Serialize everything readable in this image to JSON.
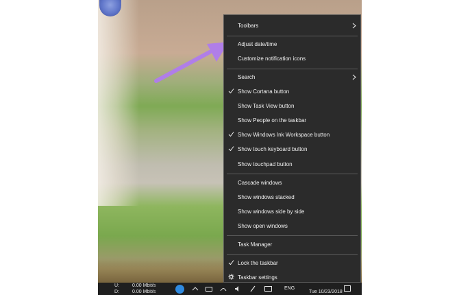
{
  "menu": {
    "items": [
      {
        "label": "Toolbars",
        "checked": false,
        "submenu": true
      },
      {
        "label": "Adjust date/time",
        "checked": false,
        "submenu": false
      },
      {
        "label": "Customize notification icons",
        "checked": false,
        "submenu": false
      },
      {
        "label": "Search",
        "checked": false,
        "submenu": true
      },
      {
        "label": "Show Cortana button",
        "checked": true,
        "submenu": false
      },
      {
        "label": "Show Task View button",
        "checked": false,
        "submenu": false
      },
      {
        "label": "Show People on the taskbar",
        "checked": false,
        "submenu": false
      },
      {
        "label": "Show Windows Ink Workspace button",
        "checked": true,
        "submenu": false
      },
      {
        "label": "Show touch keyboard button",
        "checked": true,
        "submenu": false
      },
      {
        "label": "Show touchpad button",
        "checked": false,
        "submenu": false
      },
      {
        "label": "Cascade windows",
        "checked": false,
        "submenu": false
      },
      {
        "label": "Show windows stacked",
        "checked": false,
        "submenu": false
      },
      {
        "label": "Show windows side by side",
        "checked": false,
        "submenu": false
      },
      {
        "label": "Show open windows",
        "checked": false,
        "submenu": false
      },
      {
        "label": "Task Manager",
        "checked": false,
        "submenu": false
      },
      {
        "label": "Lock the taskbar",
        "checked": true,
        "submenu": false
      },
      {
        "label": "Taskbar settings",
        "checked": false,
        "submenu": false,
        "icon": "gear-icon"
      }
    ]
  },
  "taskbar": {
    "net_upload_label": "U:",
    "net_upload_value": "0.00 Mbit/s",
    "net_download_label": "D:",
    "net_download_value": "0.00 Mbit/s",
    "language": "ENG",
    "clock": "Tue 10/23/2018"
  },
  "colors": {
    "menu_bg": "#2b2b2b",
    "menu_text": "#f1f1f1",
    "arrow": "#b07ee8"
  }
}
